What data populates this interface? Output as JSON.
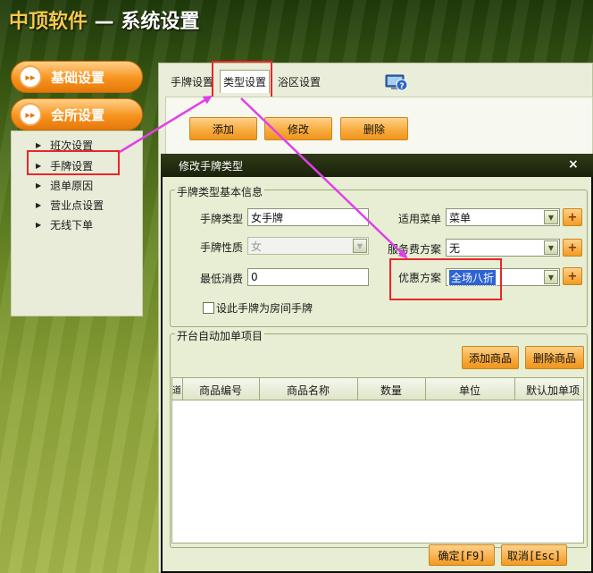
{
  "app": {
    "brand": "中顶软件",
    "sep": " — ",
    "title": "系统设置"
  },
  "nav": {
    "groups": [
      {
        "label": "基础设置"
      },
      {
        "label": "会所设置"
      }
    ],
    "items": [
      {
        "label": "班次设置"
      },
      {
        "label": "手牌设置"
      },
      {
        "label": "退单原因"
      },
      {
        "label": "营业点设置"
      },
      {
        "label": "无线下单"
      }
    ]
  },
  "tabs": [
    {
      "label": "手牌设置"
    },
    {
      "label": "类型设置"
    },
    {
      "label": "浴区设置"
    }
  ],
  "toolbar": {
    "add": "添加",
    "edit": "修改",
    "delete": "删除"
  },
  "dialog": {
    "title": "修改手牌类型",
    "close": "×",
    "basic_group": "手牌类型基本信息",
    "fields": {
      "type_label": "手牌类型",
      "type_value": "女手牌",
      "nature_label": "手牌性质",
      "nature_value": "女",
      "min_label": "最低消费",
      "min_value": "0",
      "menu_label": "适用菜单",
      "menu_value": "菜单",
      "service_label": "服务费方案",
      "service_value": "无",
      "discount_label": "优惠方案",
      "discount_value": "全场八折"
    },
    "room_checkbox": "设此手牌为房间手牌",
    "auto_group": "开台自动加单项目",
    "add_goods": "添加商品",
    "del_goods": "删除商品",
    "columns": [
      "道",
      "商品编号",
      "商品名称",
      "数量",
      "单位",
      "默认加单项"
    ],
    "confirm": "确定[F9]",
    "cancel": "取消[Esc]"
  },
  "colors": {
    "accent_orange": "#f7931e",
    "highlight_red": "#e8262b",
    "arrow_magenta": "#e040e8"
  }
}
